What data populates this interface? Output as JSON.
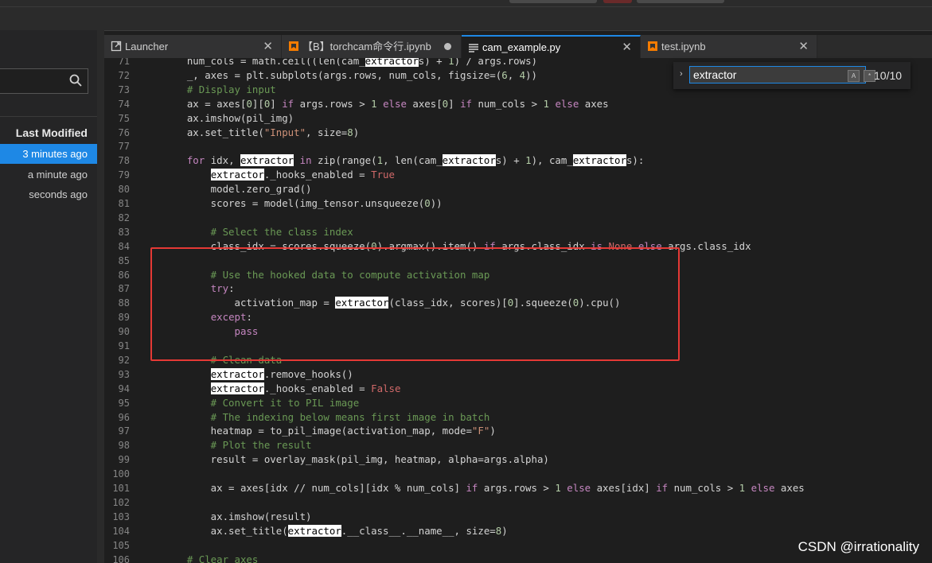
{
  "sidebar": {
    "header": "Last Modified",
    "rows": [
      "3 minutes ago",
      "a minute ago",
      "seconds ago"
    ]
  },
  "tabs": [
    {
      "label": "Launcher",
      "icon": "launcher-icon"
    },
    {
      "label": "【B】torchcam命令行.ipynb",
      "icon": "notebook-icon",
      "modified": true
    },
    {
      "label": "cam_example.py",
      "icon": "text-file-icon",
      "active": true
    },
    {
      "label": "test.ipynb",
      "icon": "notebook-icon"
    }
  ],
  "find": {
    "query": "extractor",
    "count": "10/10"
  },
  "code_lines": [
    {
      "n": "71",
      "t": "    num_cols = math.ceil((len(cam_extractors) + 1) / args.rows)"
    },
    {
      "n": "72",
      "t": "    _, axes = plt.subplots(args.rows, num_cols, figsize=(6, 4))"
    },
    {
      "n": "73",
      "t": "    # Display input"
    },
    {
      "n": "74",
      "t": "    ax = axes[0][0] if args.rows > 1 else axes[0] if num_cols > 1 else axes"
    },
    {
      "n": "75",
      "t": "    ax.imshow(pil_img)"
    },
    {
      "n": "76",
      "t": "    ax.set_title(\"Input\", size=8)"
    },
    {
      "n": "77",
      "t": ""
    },
    {
      "n": "78",
      "t": "    for idx, extractor in zip(range(1, len(cam_extractors) + 1), cam_extractors):"
    },
    {
      "n": "79",
      "t": "        extractor._hooks_enabled = True"
    },
    {
      "n": "80",
      "t": "        model.zero_grad()"
    },
    {
      "n": "81",
      "t": "        scores = model(img_tensor.unsqueeze(0))"
    },
    {
      "n": "82",
      "t": ""
    },
    {
      "n": "83",
      "t": "        # Select the class index"
    },
    {
      "n": "84",
      "t": "        class_idx = scores.squeeze(0).argmax().item() if args.class_idx is None else args.class_idx"
    },
    {
      "n": "85",
      "t": ""
    },
    {
      "n": "86",
      "t": "        # Use the hooked data to compute activation map"
    },
    {
      "n": "87",
      "t": "        try:"
    },
    {
      "n": "88",
      "t": "            activation_map = extractor(class_idx, scores)[0].squeeze(0).cpu()"
    },
    {
      "n": "89",
      "t": "        except:"
    },
    {
      "n": "90",
      "t": "            pass"
    },
    {
      "n": "91",
      "t": ""
    },
    {
      "n": "92",
      "t": "        # Clean data"
    },
    {
      "n": "93",
      "t": "        extractor.remove_hooks()"
    },
    {
      "n": "94",
      "t": "        extractor._hooks_enabled = False"
    },
    {
      "n": "95",
      "t": "        # Convert it to PIL image"
    },
    {
      "n": "96",
      "t": "        # The indexing below means first image in batch"
    },
    {
      "n": "97",
      "t": "        heatmap = to_pil_image(activation_map, mode=\"F\")"
    },
    {
      "n": "98",
      "t": "        # Plot the result"
    },
    {
      "n": "99",
      "t": "        result = overlay_mask(pil_img, heatmap, alpha=args.alpha)"
    },
    {
      "n": "100",
      "t": ""
    },
    {
      "n": "101",
      "t": "        ax = axes[idx // num_cols][idx % num_cols] if args.rows > 1 else axes[idx] if num_cols > 1 else axes"
    },
    {
      "n": "102",
      "t": ""
    },
    {
      "n": "103",
      "t": "        ax.imshow(result)"
    },
    {
      "n": "104",
      "t": "        ax.set_title(extractor.__class__.__name__, size=8)"
    },
    {
      "n": "105",
      "t": ""
    },
    {
      "n": "106",
      "t": "    # Clear axes"
    }
  ],
  "watermark": "CSDN @irrationality",
  "colors": {
    "accent": "#1e88e5",
    "annotation_box": "#e53935",
    "keyword": "#c586c0",
    "string": "#ce9178",
    "number": "#b5cea8",
    "comment": "#6a9955",
    "function": "#dcdcaa"
  }
}
